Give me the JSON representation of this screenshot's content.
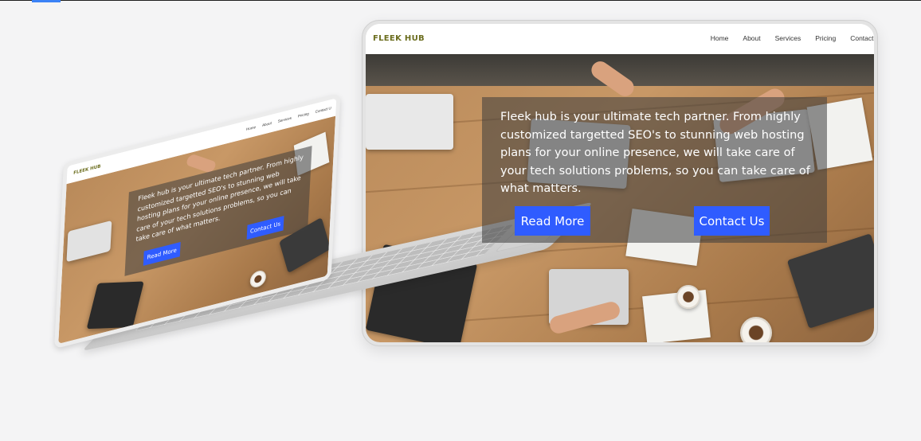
{
  "tablet": {
    "logo": "FLEEK HUB",
    "nav": [
      "Home",
      "About",
      "Services",
      "Pricing",
      "Contact U"
    ],
    "hero_text": "Fleek hub is your ultimate tech partner. From highly customized targetted SEO's to stunning web hosting plans for your online presence, we will take care of your tech solutions problems, so you can take care of what matters.",
    "read_more": "Read More",
    "contact_us": "Contact Us"
  },
  "laptop": {
    "logo": "FLEEK HUB",
    "nav": [
      "Home",
      "About",
      "Services",
      "Pricing",
      "Contact U"
    ],
    "hero_text": "Fleek hub is your ultimate tech partner. From highly customized targetted SEO's to stunning web hosting plans for your online presence, we will take care of your tech solutions problems, so you can take care of what matters.",
    "read_more": "Read More",
    "contact_us": "Contact Us"
  },
  "colors": {
    "logo": "#6b6d1e",
    "button": "#2f5cff",
    "background": "#f4f4f5"
  }
}
